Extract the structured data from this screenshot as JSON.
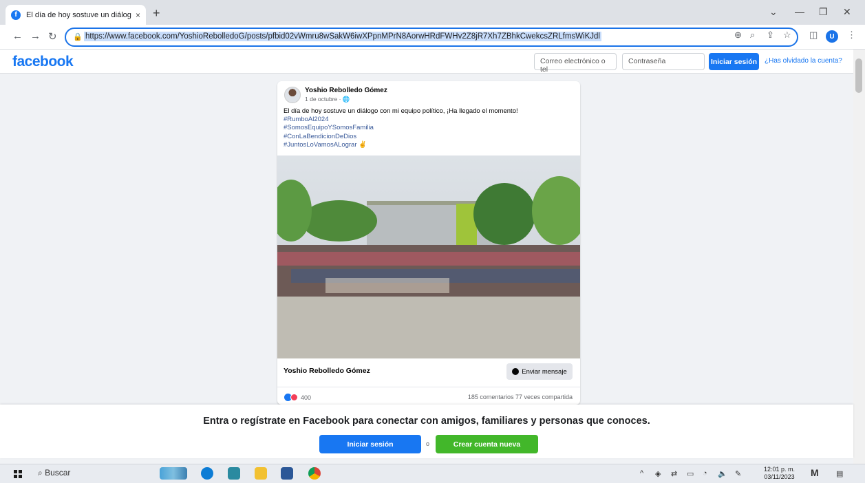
{
  "browser": {
    "tab_title": "El día de hoy sostuve un diálogo",
    "tab_close": "×",
    "new_tab": "+",
    "url": "https://www.facebook.com/YoshioRebolledoG/posts/pfbid02vWmru8wSakW6iwXPpnMPrN8AorwHRdFWHv2Z8jR7Xh7ZBhkCwekcsZRLfmsWiKJdl",
    "profile_initial": "U",
    "back_icon": "back-arrow-icon",
    "forward_icon": "forward-arrow-icon",
    "reload_icon": "reload-icon"
  },
  "fb_header": {
    "logo": "facebook",
    "email_placeholder": "Correo electrónico o tel",
    "password_placeholder": "Contraseña",
    "login_button": "Iniciar sesión",
    "forgot_link": "¿Has olvidado la cuenta?"
  },
  "post": {
    "author": "Yoshio Rebolledo Gómez",
    "date": "1 de octubre · ",
    "text": "El día de hoy sostuve un diálogo con mi equipo político, ¡Ha llegado el momento!",
    "hashtags": [
      "#RumboAl2024",
      "#SomosEquipoYSomosFamilia",
      "#ConLaBendicionDeDios",
      "#JuntosLoVamosALograr ✌"
    ],
    "footer_name": "Yoshio Rebolledo Gómez",
    "message_button": "Enviar mensaje",
    "reaction_count": "400",
    "stats": "185 comentarios  77 veces compartida"
  },
  "banner": {
    "text": "Entra o regístrate en Facebook para conectar con amigos, familiares y personas que conoces.",
    "login_button": "Iniciar sesión",
    "or": "o",
    "create_button": "Crear cuenta nueva"
  },
  "taskbar": {
    "search_label": "Buscar",
    "time": "12:01 p. m.",
    "date": "03/11/2023"
  },
  "colors": {
    "facebook_blue": "#1877f2",
    "create_green": "#42b72a"
  }
}
